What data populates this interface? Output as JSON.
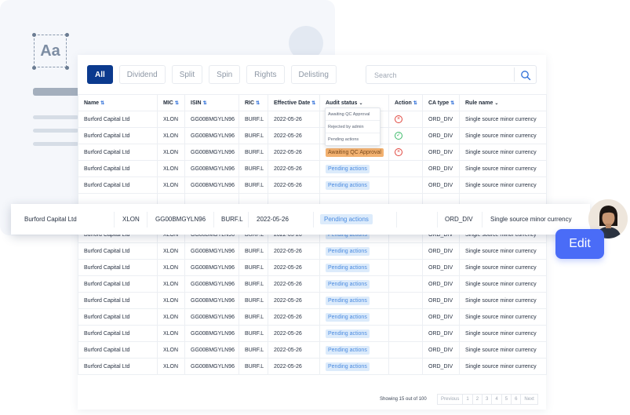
{
  "decor": {
    "aa_label": "Aa"
  },
  "tabs": [
    {
      "label": "All",
      "active": true
    },
    {
      "label": "Dividend",
      "active": false
    },
    {
      "label": "Split",
      "active": false
    },
    {
      "label": "Spin",
      "active": false
    },
    {
      "label": "Rights",
      "active": false
    },
    {
      "label": "Delisting",
      "active": false
    }
  ],
  "search": {
    "placeholder": "Search"
  },
  "table": {
    "columns": [
      "Name",
      "MIC",
      "ISIN",
      "RIC",
      "Effective Date",
      "Audit status",
      "Action",
      "CA type",
      "Rule name"
    ],
    "sortable": [
      true,
      true,
      true,
      true,
      true,
      false,
      true,
      true,
      false
    ],
    "dropdown_columns": [
      "Audit status",
      "Rule name"
    ],
    "rows": [
      {
        "name": "Burford Capital Ltd",
        "mic": "XLON",
        "isin": "GG00BMGYLN96",
        "ric": "BURF.L",
        "date": "2022-05-26",
        "status": "",
        "status_style": "orange",
        "action": "reject",
        "ca_type": "ORD_DIV",
        "rule": "Single source minor currency"
      },
      {
        "name": "Burford Capital Ltd",
        "mic": "XLON",
        "isin": "GG00BMGYLN96",
        "ric": "BURF.L",
        "date": "2022-05-26",
        "status": "",
        "status_style": "",
        "action": "approve",
        "ca_type": "ORD_DIV",
        "rule": "Single source minor currency"
      },
      {
        "name": "Burford Capital Ltd",
        "mic": "XLON",
        "isin": "GG00BMGYLN96",
        "ric": "BURF.L",
        "date": "2022-05-26",
        "status": "Awaiting QC Approval",
        "status_style": "orange",
        "action": "reject",
        "ca_type": "ORD_DIV",
        "rule": "Single source minor currency"
      },
      {
        "name": "Burford Capital Ltd",
        "mic": "XLON",
        "isin": "GG00BMGYLN96",
        "ric": "BURF.L",
        "date": "2022-05-26",
        "status": "Pending actions",
        "status_style": "blue",
        "action": "",
        "ca_type": "ORD_DIV",
        "rule": "Single source minor currency"
      },
      {
        "name": "Burford Capital Ltd",
        "mic": "XLON",
        "isin": "GG00BMGYLN96",
        "ric": "BURF.L",
        "date": "2022-05-26",
        "status": "Pending actions",
        "status_style": "blue",
        "action": "",
        "ca_type": "ORD_DIV",
        "rule": "Single source minor currency"
      },
      {
        "name": "",
        "mic": "",
        "isin": "",
        "ric": "",
        "date": "",
        "status": "",
        "status_style": "",
        "action": "",
        "ca_type": "",
        "rule": ""
      },
      {
        "name": "",
        "mic": "",
        "isin": "",
        "ric": "",
        "date": "",
        "status": "",
        "status_style": "",
        "action": "",
        "ca_type": "",
        "rule": ""
      },
      {
        "name": "Burford Capital Ltd",
        "mic": "XLON",
        "isin": "GG00BMGYLN96",
        "ric": "BURF.L",
        "date": "2022-05-26",
        "status": "Pending actions",
        "status_style": "blue",
        "action": "",
        "ca_type": "ORD_DIV",
        "rule": "Single source minor currency"
      },
      {
        "name": "Burford Capital Ltd",
        "mic": "XLON",
        "isin": "GG00BMGYLN96",
        "ric": "BURF.L",
        "date": "2022-05-26",
        "status": "Pending actions",
        "status_style": "blue",
        "action": "",
        "ca_type": "ORD_DIV",
        "rule": "Single source minor currency"
      },
      {
        "name": "Burford Capital Ltd",
        "mic": "XLON",
        "isin": "GG00BMGYLN96",
        "ric": "BURF.L",
        "date": "2022-05-26",
        "status": "Pending actions",
        "status_style": "blue",
        "action": "",
        "ca_type": "ORD_DIV",
        "rule": "Single source minor currency"
      },
      {
        "name": "Burford Capital Ltd",
        "mic": "XLON",
        "isin": "GG00BMGYLN96",
        "ric": "BURF.L",
        "date": "2022-05-26",
        "status": "Pending actions",
        "status_style": "blue",
        "action": "",
        "ca_type": "ORD_DIV",
        "rule": "Single source minor currency"
      },
      {
        "name": "Burford Capital Ltd",
        "mic": "XLON",
        "isin": "GG00BMGYLN96",
        "ric": "BURF.L",
        "date": "2022-05-26",
        "status": "Pending actions",
        "status_style": "blue",
        "action": "",
        "ca_type": "ORD_DIV",
        "rule": "Single source minor currency"
      },
      {
        "name": "Burford Capital Ltd",
        "mic": "XLON",
        "isin": "GG00BMGYLN96",
        "ric": "BURF.L",
        "date": "2022-05-26",
        "status": "Pending actions",
        "status_style": "blue",
        "action": "",
        "ca_type": "ORD_DIV",
        "rule": "Single source minor currency"
      },
      {
        "name": "Burford Capital Ltd",
        "mic": "XLON",
        "isin": "GG00BMGYLN96",
        "ric": "BURF.L",
        "date": "2022-05-26",
        "status": "Pending actions",
        "status_style": "blue",
        "action": "",
        "ca_type": "ORD_DIV",
        "rule": "Single source minor currency"
      },
      {
        "name": "Burford Capital Ltd",
        "mic": "XLON",
        "isin": "GG00BMGYLN96",
        "ric": "BURF.L",
        "date": "2022-05-26",
        "status": "Pending actions",
        "status_style": "blue",
        "action": "",
        "ca_type": "ORD_DIV",
        "rule": "Single source minor currency"
      },
      {
        "name": "Burford Capital Ltd",
        "mic": "XLON",
        "isin": "GG00BMGYLN96",
        "ric": "BURF.L",
        "date": "2022-05-26",
        "status": "Pending actions",
        "status_style": "blue",
        "action": "",
        "ca_type": "ORD_DIV",
        "rule": "Single source minor currency"
      }
    ]
  },
  "dropdown": {
    "options": [
      "Awaiting QC Approval",
      "Rejected by admin",
      "Pending actions"
    ]
  },
  "highlight_row": {
    "name": "Burford Capital Ltd",
    "mic": "XLON",
    "isin": "GG00BMGYLN96",
    "ric": "BURF.L",
    "date": "2022-05-26",
    "status": "Pending actions",
    "ca_type": "ORD_DIV",
    "rule": "Single source minor currency"
  },
  "edit_button": {
    "label": "Edit"
  },
  "footer": {
    "showing": "Showing 15 out of 100",
    "pager": [
      "Previous",
      "1",
      "2",
      "3",
      "4",
      "5",
      "6",
      "Next"
    ]
  },
  "colors": {
    "primary": "#0b3a8e",
    "accent": "#4a6cf7",
    "pending_bg": "#dcebfb",
    "awaiting_bg": "#f2b170",
    "reject": "#e0473f",
    "approve": "#3dbb6a"
  }
}
